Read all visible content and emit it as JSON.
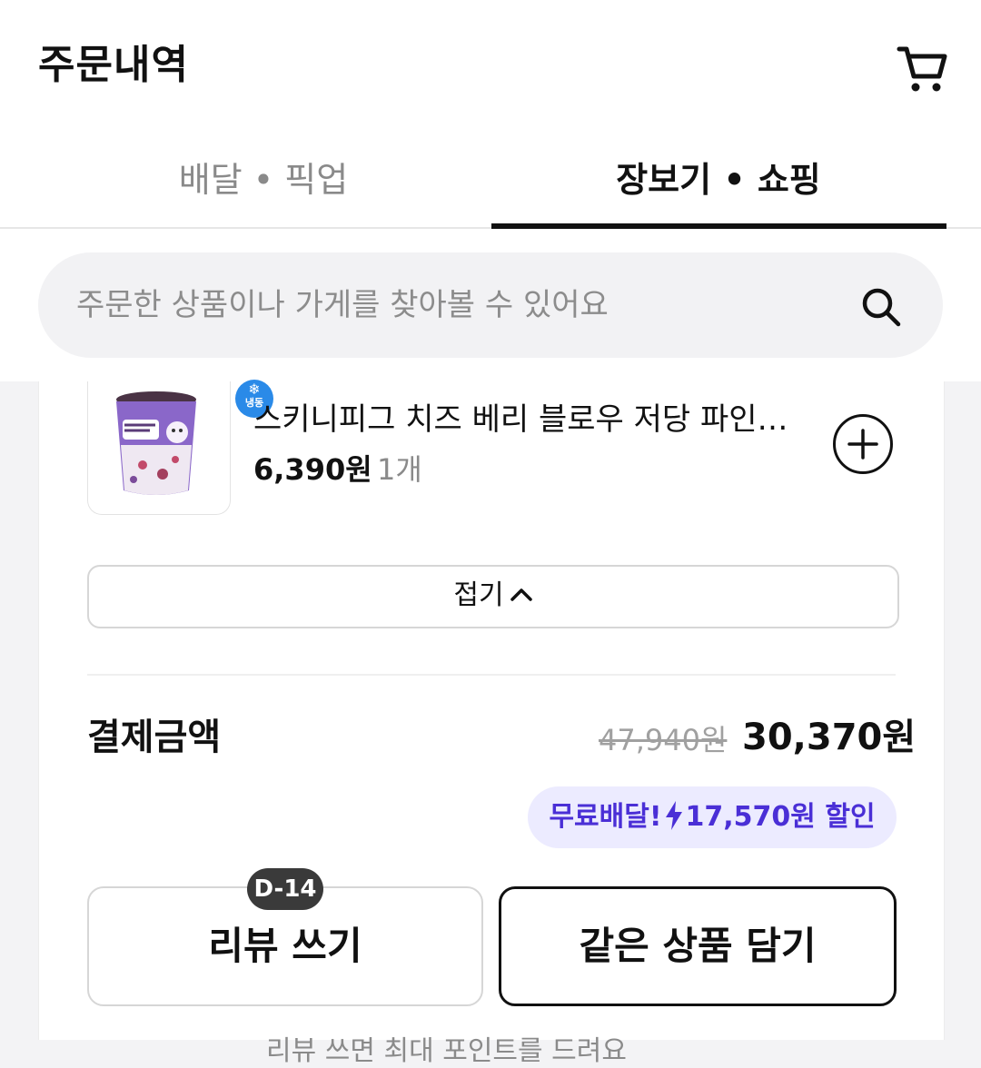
{
  "header": {
    "title": "주문내역",
    "cart_icon": "cart-icon"
  },
  "tabs": [
    {
      "label": "배달 • 픽업",
      "active": false
    },
    {
      "label": "장보기 • 쇼핑",
      "active": true
    }
  ],
  "search": {
    "placeholder": "주문한 상품이나 가게를 찾아볼 수 있어요",
    "icon": "search-icon"
  },
  "order_item": {
    "frozen_label": "냉동",
    "name": "스키니피그 치즈 베리 블로우 저당 파인…",
    "price": "6,390원",
    "quantity": "1개",
    "add_icon": "plus-circle-icon"
  },
  "fold_button": {
    "label": "접기"
  },
  "payment": {
    "label": "결제금액",
    "original_price": "47,940원",
    "final_price": "30,370원",
    "discount_prefix": "무료배달!",
    "discount_amount": "17,570원 할인"
  },
  "actions": {
    "review_label": "리뷰 쓰기",
    "review_dday": "D-14",
    "same_items_label": "같은 상품 담기"
  },
  "bottom_note": {
    "text_before": "리뷰 쓰면 최대",
    "accent": "",
    "text_after": "포인트를 드려요"
  },
  "colors": {
    "accent_purple": "#4a2fd6",
    "badge_bg": "#ecebff",
    "frozen_blue": "#2a8ae8"
  }
}
